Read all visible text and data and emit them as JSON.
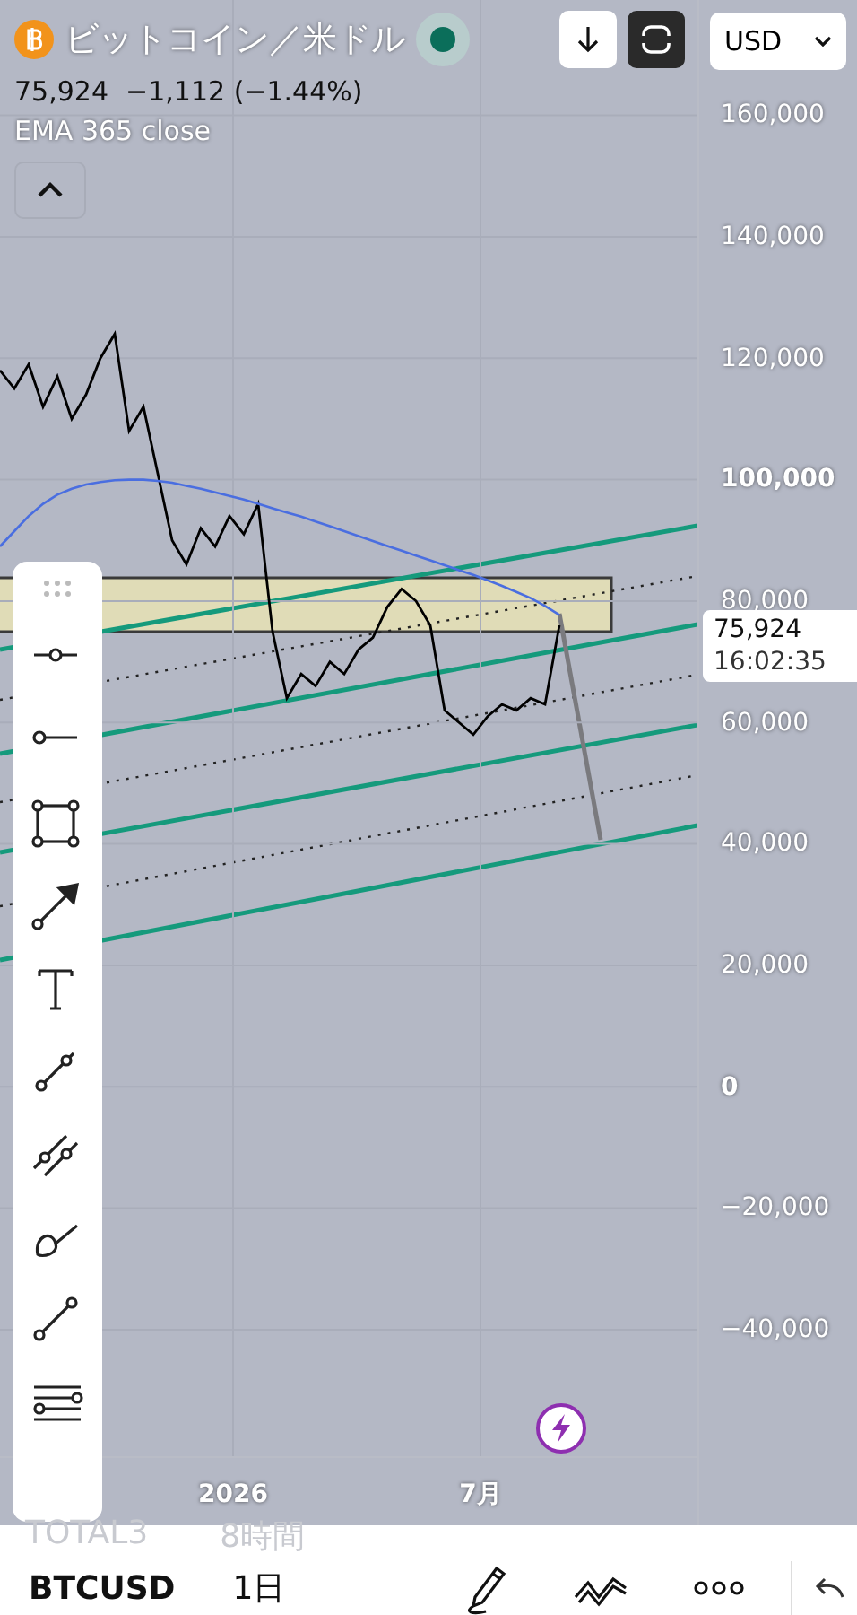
{
  "header": {
    "title": "ビットコイン／米ドル",
    "price": "75,924",
    "change": "−1,112 (−1.44%)",
    "indicator": "EMA 365 close",
    "currency": "USD"
  },
  "chart": {
    "price_label": {
      "price": "75,924",
      "time": "16:02:35"
    },
    "x_axis_labels": [
      "2026",
      "7月"
    ],
    "chart_data": {
      "type": "line",
      "grid": true,
      "ylim": [
        -61000,
        179000
      ],
      "yticks": [
        {
          "value": 160000,
          "label": "160,000"
        },
        {
          "value": 140000,
          "label": "140,000"
        },
        {
          "value": 120000,
          "label": "120,000"
        },
        {
          "value": 100000,
          "label": "100,000"
        },
        {
          "value": 80000,
          "label": "80,000"
        },
        {
          "value": 60000,
          "label": "60,000"
        },
        {
          "value": 40000,
          "label": "40,000"
        },
        {
          "value": 20000,
          "label": "20,000"
        },
        {
          "value": 0,
          "label": "0"
        },
        {
          "value": -20000,
          "label": "−20,000"
        },
        {
          "value": -40000,
          "label": "−40,000"
        }
      ],
      "series": [
        {
          "color": "#000000",
          "values": [
            118000,
            115000,
            119000,
            112000,
            117000,
            110000,
            114000,
            120000,
            124000,
            108000,
            112000,
            101000,
            90000,
            86000,
            92000,
            89000,
            94000,
            91000,
            96000,
            75000,
            64000,
            68000,
            66000,
            70000,
            68000,
            72000,
            74000,
            79000,
            82000,
            80000,
            76000,
            62000,
            60000,
            58000,
            61000,
            63000,
            62000,
            64000,
            63000,
            76000
          ]
        },
        {
          "color": "#4a6ee0",
          "values": [
            89000,
            91500,
            94000,
            96000,
            97500,
            98500,
            99200,
            99600,
            99900,
            100000,
            100000,
            99800,
            99500,
            99000,
            98500,
            97900,
            97300,
            96700,
            96000,
            95300,
            94600,
            93900,
            93100,
            92300,
            91500,
            90700,
            89900,
            89100,
            88300,
            87500,
            86700,
            85900,
            85100,
            84300,
            83400,
            82500,
            81500,
            80500,
            79200,
            77700
          ]
        }
      ]
    }
  },
  "bottom_bar": {
    "secondary": [
      "TOTAL3",
      "8時間"
    ],
    "symbol": "BTCUSD",
    "interval": "1日"
  }
}
